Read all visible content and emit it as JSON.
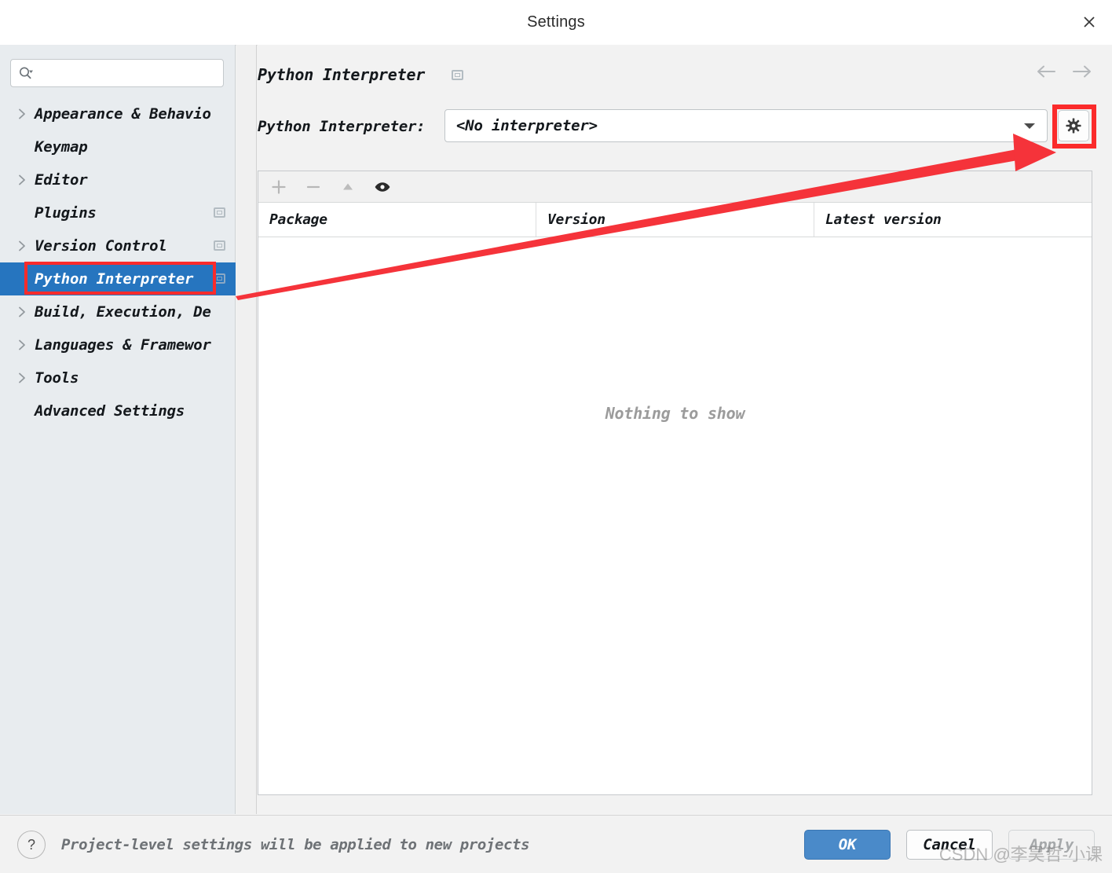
{
  "window": {
    "title": "Settings",
    "close_icon": "close-icon"
  },
  "sidebar": {
    "search": {
      "value": "",
      "placeholder": "",
      "icon": "search-icon"
    },
    "items": [
      {
        "label": "Appearance & Behavio",
        "expandable": true,
        "selected": false,
        "badge": false
      },
      {
        "label": "Keymap",
        "expandable": false,
        "selected": false,
        "badge": false
      },
      {
        "label": "Editor",
        "expandable": true,
        "selected": false,
        "badge": false
      },
      {
        "label": "Plugins",
        "expandable": false,
        "selected": false,
        "badge": true
      },
      {
        "label": "Version Control",
        "expandable": true,
        "selected": false,
        "badge": true
      },
      {
        "label": "Python Interpreter",
        "expandable": false,
        "selected": true,
        "badge": true
      },
      {
        "label": "Build, Execution, De",
        "expandable": true,
        "selected": false,
        "badge": false
      },
      {
        "label": "Languages & Framewor",
        "expandable": true,
        "selected": false,
        "badge": false
      },
      {
        "label": "Tools",
        "expandable": true,
        "selected": false,
        "badge": false
      },
      {
        "label": "Advanced Settings",
        "expandable": false,
        "selected": false,
        "badge": false
      }
    ]
  },
  "content": {
    "page_title": "Python Interpreter",
    "nav": {
      "back_icon": "arrow-left-icon",
      "forward_icon": "arrow-right-icon"
    },
    "interpreter": {
      "label": "Python Interpreter:",
      "selected_value": "<No interpreter>",
      "dropdown_icon": "chevron-down-icon",
      "gear_icon": "gear-icon"
    },
    "packages": {
      "toolbar": [
        {
          "icon": "plus-icon",
          "name": "add-package-button",
          "enabled": false
        },
        {
          "icon": "minus-icon",
          "name": "remove-package-button",
          "enabled": false
        },
        {
          "icon": "upgrade-icon",
          "name": "upgrade-package-button",
          "enabled": false
        },
        {
          "icon": "eye-icon",
          "name": "show-early-releases-button",
          "enabled": true
        }
      ],
      "columns": [
        "Package",
        "Version",
        "Latest version"
      ],
      "rows": [],
      "empty_text": "Nothing to show"
    }
  },
  "footer": {
    "help_label": "?",
    "note": "Project-level settings will be applied to new projects",
    "ok_label": "OK",
    "cancel_label": "Cancel",
    "apply_label": "Apply"
  },
  "annotations": {
    "highlight_color": "#fb2b2b",
    "arrow_label": "arrow from Python Interpreter sidebar entry to gear button"
  },
  "watermark": {
    "text": "CSDN @李昊哲-小课"
  }
}
